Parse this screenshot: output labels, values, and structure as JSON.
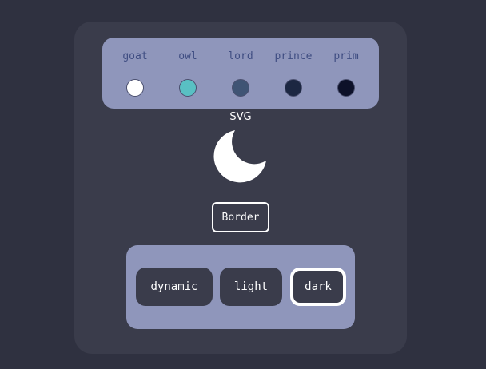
{
  "swatches": [
    {
      "label": "goat",
      "color": "#ffffff"
    },
    {
      "label": "owl",
      "color": "#59c0c3"
    },
    {
      "label": "lord",
      "color": "#3f5474"
    },
    {
      "label": "prince",
      "color": "#1c2742"
    },
    {
      "label": "prim",
      "color": "#0d1129"
    }
  ],
  "svg_label": "SVG",
  "icon": "moon-icon",
  "border_button": "Border",
  "theme": {
    "buttons": [
      "dynamic",
      "light",
      "dark"
    ],
    "selected": "dark"
  },
  "colors": {
    "background": "#2f3140",
    "card": "#3a3c4b",
    "panel": "#8f96bb",
    "swatch_label": "#3f4d82"
  }
}
